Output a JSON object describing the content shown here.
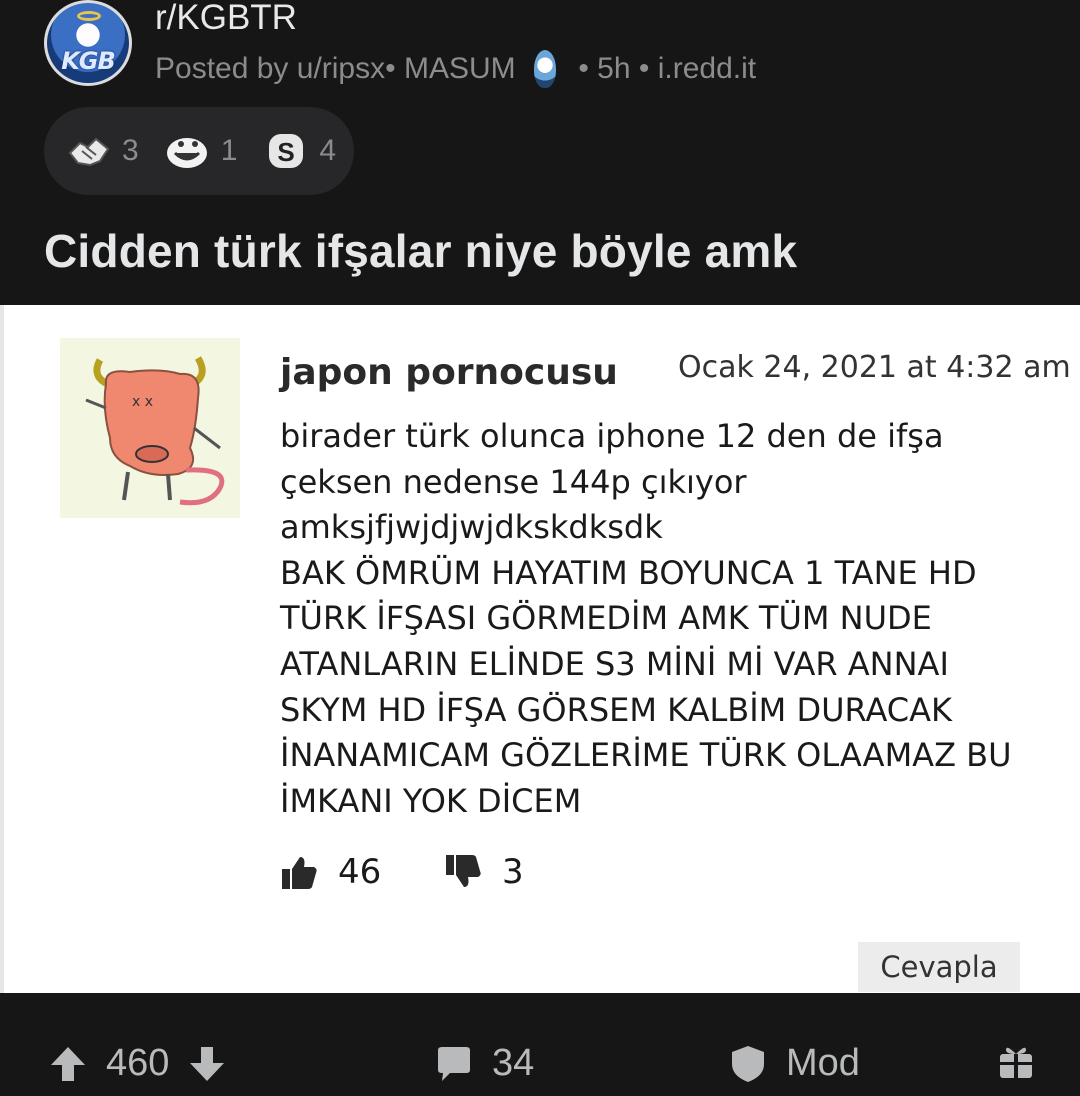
{
  "post": {
    "subreddit": "r/KGBTR",
    "posted_by": "Posted by u/ripsx•",
    "flair": "MASUM",
    "time": "• 5h",
    "domain": "• i.redd.it",
    "avatar_text": "KGB",
    "awards": [
      {
        "icon": "handshake-award-icon",
        "count": "3"
      },
      {
        "icon": "laughing-face-award-icon",
        "count": "1"
      },
      {
        "icon": "s-coin-award-icon",
        "count": "4"
      }
    ],
    "title": "Cidden türk ifşalar niye böyle amk"
  },
  "comment": {
    "author": "japon pornocusu",
    "date": "Ocak 24, 2021 at 4:32 am",
    "lines": [
      "birader türk olunca iphone 12 den de ifşa",
      "çeksen nedense 144p çıkıyor",
      "amksjfjwjdjwjdkskdksdk",
      "BAK ÖMRÜM HAYATIM BOYUNCA 1 TANE HD",
      "TÜRK İFŞASI GÖRMEDİM AMK TÜM NUDE",
      "ATANLARIN ELİNDE S3 MİNİ Mİ VAR ANNAI",
      "SKYM HD İFŞA GÖRSEM KALBİM DURACAK",
      "İNANAMICAM GÖZLERİME TÜRK OLAAMAZ BU",
      "İMKANI YOK DİCEM"
    ],
    "likes": "46",
    "dislikes": "3",
    "reply_label": "Cevapla"
  },
  "footer": {
    "score": "460",
    "comments": "34",
    "mod_label": "Mod"
  },
  "colors": {
    "background": "#161617",
    "award_pill": "#27272a",
    "muted_text": "#8a8c8e",
    "image_bg": "#ffffff"
  }
}
